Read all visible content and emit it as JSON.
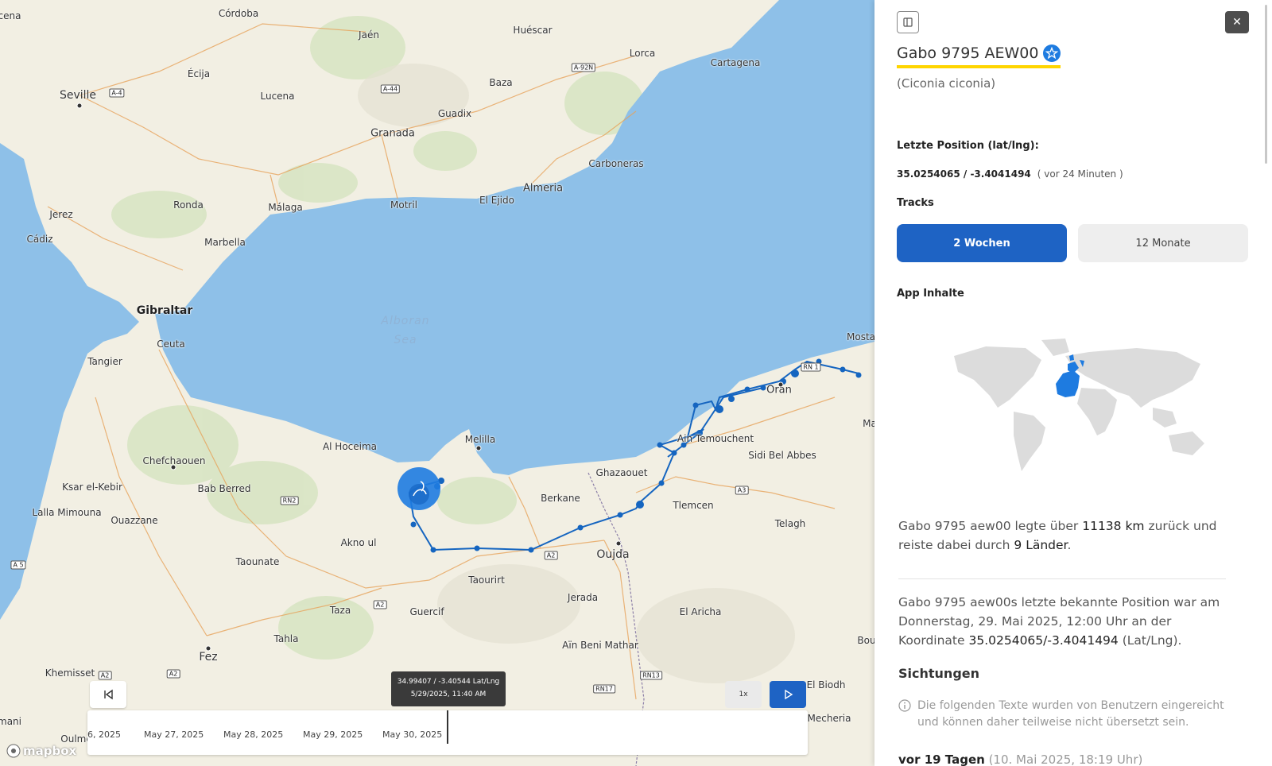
{
  "map": {
    "places": [
      {
        "name": "Córdoba"
      },
      {
        "name": "Jaén"
      },
      {
        "name": "Huéscar"
      },
      {
        "name": "Lorca"
      },
      {
        "name": "Cartagena"
      },
      {
        "name": "Seville"
      },
      {
        "name": "Écija"
      },
      {
        "name": "Lucena"
      },
      {
        "name": "Baza"
      },
      {
        "name": "Guadix"
      },
      {
        "name": "Granada"
      },
      {
        "name": "Carboneras"
      },
      {
        "name": "Ronda"
      },
      {
        "name": "Jerez"
      },
      {
        "name": "Málaga"
      },
      {
        "name": "Motril"
      },
      {
        "name": "El Ejido"
      },
      {
        "name": "Almeria"
      },
      {
        "name": "Cádiz"
      },
      {
        "name": "Marbella"
      },
      {
        "name": "Gibraltar"
      },
      {
        "name": "Ceuta"
      },
      {
        "name": "Tangier"
      },
      {
        "name": "Mosta"
      },
      {
        "name": "Oran"
      },
      {
        "name": "Chefchaouen"
      },
      {
        "name": "Ksar el-Kebir"
      },
      {
        "name": "Bab Berred"
      },
      {
        "name": "Al Hoceima"
      },
      {
        "name": "Melilla"
      },
      {
        "name": "Lalla Mimouna"
      },
      {
        "name": "Ouazzane"
      },
      {
        "name": "Ghazaouet"
      },
      {
        "name": "Ain Temouchent"
      },
      {
        "name": "Sidi Bel Abbes"
      },
      {
        "name": "Berkane"
      },
      {
        "name": "Tlemcen"
      },
      {
        "name": "Akno ul"
      },
      {
        "name": "Taounate"
      },
      {
        "name": "Oujda"
      },
      {
        "name": "Taourirt"
      },
      {
        "name": "Telagh"
      },
      {
        "name": "Jerada"
      },
      {
        "name": "Taza"
      },
      {
        "name": "Guercif"
      },
      {
        "name": "El Aricha"
      },
      {
        "name": "Tahla"
      },
      {
        "name": "Aïn Beni Mathar"
      },
      {
        "name": "Fez"
      },
      {
        "name": "Khemisset"
      },
      {
        "name": "El Biodh"
      },
      {
        "name": "Mecheria"
      },
      {
        "name": "Oulme"
      },
      {
        "name": "mani"
      },
      {
        "name": "cena"
      },
      {
        "name": "Ma"
      },
      {
        "name": "Bou"
      }
    ],
    "sea_label": "Alboran Sea",
    "roads": [
      "A-4",
      "A-44",
      "A-92N",
      "A 5",
      "RN2",
      "A2",
      "A2",
      "A2",
      "A2",
      "RN17",
      "RN13",
      "A3",
      "RN 1"
    ],
    "mapbox_label": "mapbox"
  },
  "controls": {
    "tooltip_coords": "34.99407 / -3.40544 Lat/Lng",
    "tooltip_time": "5/29/2025, 11:40 AM",
    "speed_label": "1x",
    "timeline_dates": [
      "6, 2025",
      "May 27, 2025",
      "May 28, 2025",
      "May 29, 2025",
      "May 30, 2025"
    ]
  },
  "panel": {
    "title": "Gabo 9795 AEW00",
    "species": "(Ciconia ciconia)",
    "last_position_label": "Letzte Position (lat/lng):",
    "last_position_value": "35.0254065 / -3.4041494",
    "last_position_ago": "( vor 24 Minuten )",
    "tracks_label": "Tracks",
    "track_options": [
      "2 Wochen",
      "12 Monate"
    ],
    "app_content_label": "App Inhalte",
    "summary_pre": "Gabo 9795 aew00 legte über ",
    "summary_km": "11138 km",
    "summary_mid": " zurück und reiste dabei durch ",
    "summary_countries": "9 Länder",
    "summary_post": ".",
    "position_pre": "Gabo 9795 aew00s letzte bekannte Position war am Donnerstag, 29. Mai 2025, 12:00 Uhr an der Koordinate ",
    "position_coords": "35.0254065/-3.4041494",
    "position_post": " (Lat/Lng).",
    "sightings_heading": "Sichtungen",
    "sightings_info": "Die folgenden Texte wurden von Benutzern eingereicht und können daher teilweise nicht übersetzt sein.",
    "sighting_ago": "vor 19 Tagen",
    "sighting_date": " (10. Mai 2025, 18:19 Uhr)"
  },
  "colors": {
    "water": "#8ec0e8",
    "land": "#f2efe3",
    "track": "#1565c0",
    "primary_button": "#1e63c4",
    "secondary_button": "#eeeeee",
    "highlight": "#ffd500"
  }
}
